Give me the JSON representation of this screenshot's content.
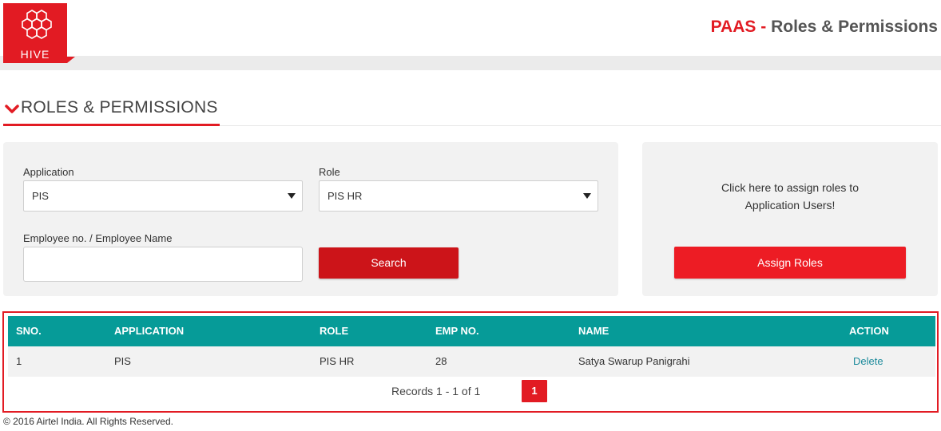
{
  "header": {
    "logo_text": "HIVE",
    "brand": "PAAS",
    "separator": "-",
    "title": "Roles & Permissions"
  },
  "section": {
    "title": "ROLES & PERMISSIONS",
    "icon": "chevron-down-icon"
  },
  "filters": {
    "application_label": "Application",
    "application_value": "PIS",
    "role_label": "Role",
    "role_value": "PIS HR",
    "employee_label": "Employee no. / Employee Name",
    "employee_value": "",
    "search_button": "Search"
  },
  "assign": {
    "text_line1": "Click here to assign roles to",
    "text_line2": "Application Users!",
    "button": "Assign Roles"
  },
  "table": {
    "columns": [
      "SNO.",
      "APPLICATION",
      "ROLE",
      "EMP NO.",
      "NAME",
      "ACTION"
    ],
    "rows": [
      {
        "sno": "1",
        "application": "PIS",
        "role": "PIS HR",
        "emp_no": "28",
        "name": "Satya Swarup Panigrahi",
        "action": "Delete"
      }
    ],
    "records_text": "Records 1 - 1 of 1",
    "current_page": "1"
  },
  "footer": {
    "text": "© 2016 Airtel India. All Rights Reserved."
  },
  "colors": {
    "brand_red": "#e21b23",
    "search_red": "#cc1419",
    "teal_header": "#069b98",
    "link": "#1e8b9c"
  }
}
